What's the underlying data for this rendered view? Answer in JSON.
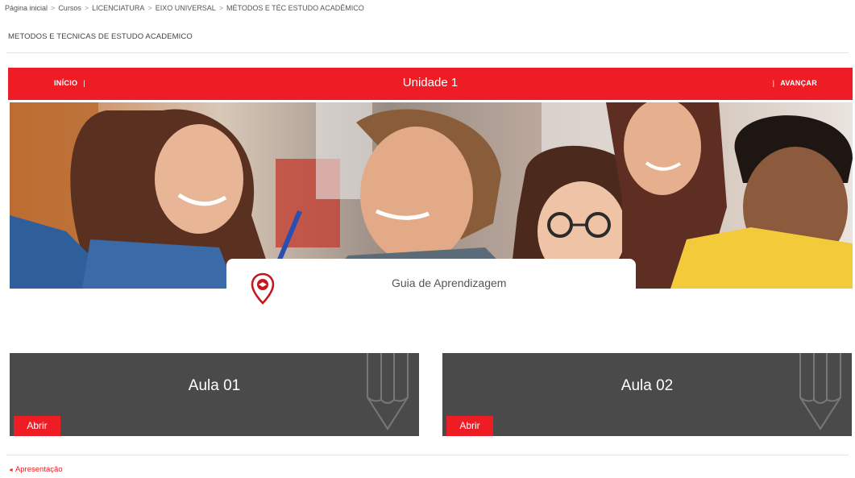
{
  "breadcrumb": {
    "items": [
      "Página inicial",
      "Cursos",
      "LICENCIATURA",
      "EIXO UNIVERSAL",
      "MÉTODOS E TÉC ESTUDO ACADÊMICO"
    ],
    "separator": ">"
  },
  "course": {
    "title": "METODOS E TECNICAS DE ESTUDO ACADEMICO"
  },
  "unit_bar": {
    "title": "Unidade 1",
    "start_label": "INÍCIO",
    "next_label": "AVANÇAR",
    "pipe": "|",
    "color": "#ee1c25"
  },
  "banner": {
    "description_icon": "students-photo"
  },
  "guide": {
    "label": "Guia de Aprendizagem",
    "icon": "map-pin-icon"
  },
  "lessons": [
    {
      "title": "Aula 01",
      "button": "Abrir",
      "icon": "pencil-icon"
    },
    {
      "title": "Aula 02",
      "button": "Abrir",
      "icon": "pencil-icon"
    }
  ],
  "footer": {
    "prev_label": "Apresentação",
    "prev_icon": "◄"
  }
}
